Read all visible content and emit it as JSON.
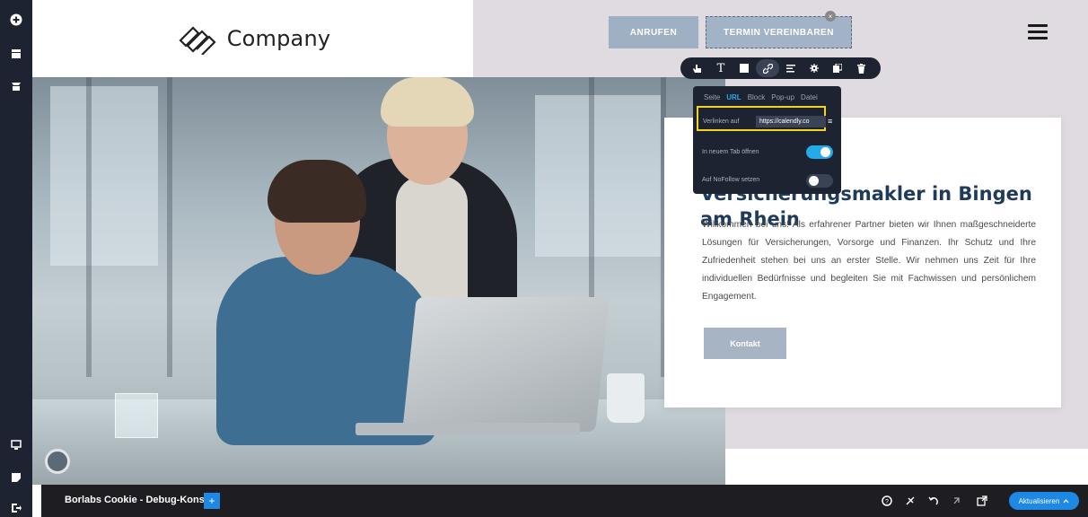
{
  "header": {
    "logo_text": "Company",
    "btn_call": "ANRUFEN",
    "btn_book": "TERMIN VEREINBAREN"
  },
  "card": {
    "title": "Wir sind Ihr Versicherungsmakler in Bingen am Rhein",
    "text": "Willkommen bei uns! Als erfahrener Partner bieten wir Ihnen maßgeschneiderte Lösungen für Versicherungen, Vorsorge und Finanzen. Ihr Schutz und Ihre Zufriedenheit stehen bei uns an erster Stelle. Wir nehmen uns Zeit für Ihre individuellen Bedürfnisse und begleiten Sie mit Fachwissen und persönlichem Engagement.",
    "button": "Kontakt"
  },
  "link_popup": {
    "tabs": [
      "Seite",
      "URL",
      "Block",
      "Pop-up",
      "Datei"
    ],
    "link_label": "Verlinken auf",
    "url_value": "https://calendly.co",
    "new_tab_label": "In neuem Tab öffnen",
    "nofollow_label": "Auf NoFollow setzen",
    "new_tab_on": true,
    "nofollow_on": false
  },
  "debug": {
    "title": "Borlabs Cookie - Debug-Konsole",
    "plus": "+",
    "update_button": "Aktualisieren"
  },
  "colors": {
    "sidebar": "#1d2331",
    "header_button": "#9fb0c5",
    "accent_blue": "#25a9e8",
    "title_navy": "#1f3a5a",
    "highlight_yellow": "#f1d521"
  }
}
